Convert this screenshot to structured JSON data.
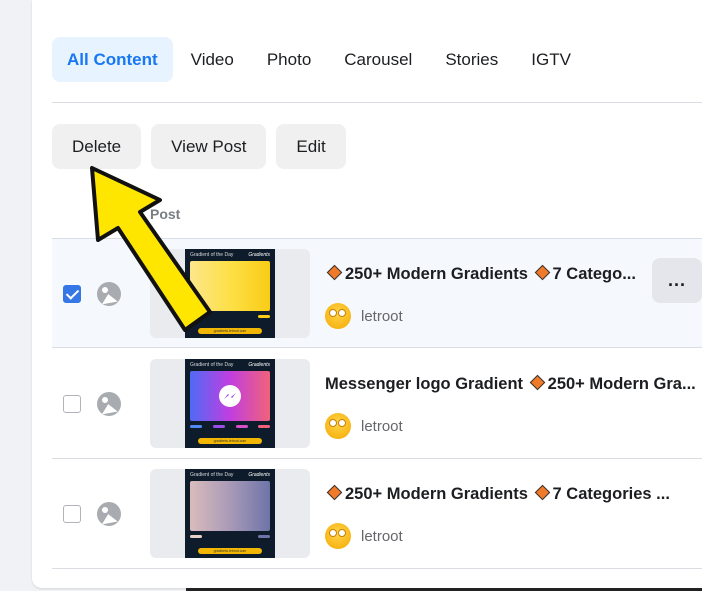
{
  "tabs": [
    {
      "label": "All Content",
      "active": true
    },
    {
      "label": "Video",
      "active": false
    },
    {
      "label": "Photo",
      "active": false
    },
    {
      "label": "Carousel",
      "active": false
    },
    {
      "label": "Stories",
      "active": false
    },
    {
      "label": "IGTV",
      "active": false
    }
  ],
  "actions": {
    "delete_label": "Delete",
    "view_post_label": "View Post",
    "edit_label": "Edit"
  },
  "table": {
    "post_column_header": "Post"
  },
  "posts": [
    {
      "selected": true,
      "type_icon": "photo-icon",
      "thumbnail": {
        "title": "Gradient of the Day",
        "logo": "Gradients",
        "url": "gradients.letroot.com",
        "gradient": [
          "#fde68a",
          "#fde047",
          "#facc15"
        ]
      },
      "title_parts": [
        "250+ Modern Gradients",
        "7 Catego..."
      ],
      "title_prefix_diamond": true,
      "author": "letroot",
      "more_label": "..."
    },
    {
      "selected": false,
      "type_icon": "photo-icon",
      "thumbnail": {
        "title": "Gradient of the Day",
        "logo": "Gradients",
        "url": "gradients.letroot.com",
        "gradient": [
          "#4f6af5",
          "#c13ee0",
          "#f0627a"
        ]
      },
      "title_parts": [
        "Messenger logo Gradient",
        "250+ Modern Gra..."
      ],
      "title_prefix_diamond": false,
      "author": "letroot"
    },
    {
      "selected": false,
      "type_icon": "photo-icon",
      "thumbnail": {
        "title": "Gradient of the Day",
        "logo": "Gradients",
        "url": "gradients.letroot.com",
        "gradient": [
          "#d9bcbc",
          "#a99ab8",
          "#6e74a8"
        ]
      },
      "title_parts": [
        "250+ Modern Gradients",
        "7 Categories ..."
      ],
      "title_prefix_diamond": true,
      "author": "letroot"
    }
  ],
  "colors": {
    "accent": "#1877f2",
    "checkbox": "#3578e5",
    "arrow": "#ffe600"
  }
}
